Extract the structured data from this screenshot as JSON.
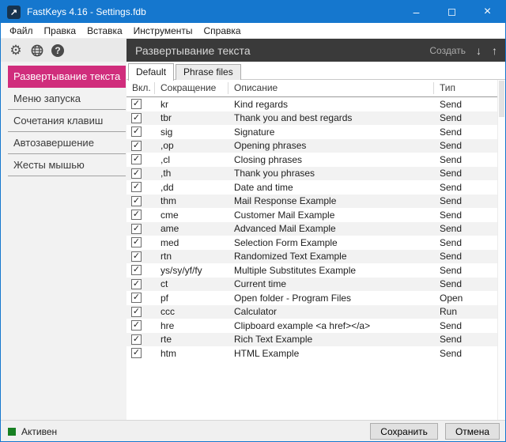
{
  "colors": {
    "titlebar": "#1577CE",
    "accent": "#D02D7C",
    "dark": "#3A3A3A",
    "green": "#178022"
  },
  "icons": {
    "app_arrow": "↗",
    "minimize": "–",
    "close": "×",
    "gear": "⚙",
    "help": "?",
    "arrow_down": "↓",
    "arrow_up": "↑",
    "check": "✓"
  },
  "window": {
    "title": "FastKeys 4.16  - Settings.fdb"
  },
  "menu": {
    "items": [
      "Файл",
      "Правка",
      "Вставка",
      "Инструменты",
      "Справка"
    ]
  },
  "sidebar": {
    "active_index": 0,
    "items": [
      "Развертывание текста",
      "Меню запуска",
      "Сочетания клавиш",
      "Автозавершение",
      "Жесты мышью"
    ]
  },
  "panel": {
    "header": {
      "title": "Развертывание текста",
      "create_label": "Создать"
    },
    "tabs": [
      {
        "label": "Default",
        "active": true
      },
      {
        "label": "Phrase files",
        "active": false
      }
    ]
  },
  "table": {
    "columns": [
      "Вкл.",
      "Сокращение",
      "Описание",
      "Тип"
    ],
    "rows": [
      {
        "enabled": true,
        "abbr": "kr",
        "desc": "Kind regards",
        "type": "Send"
      },
      {
        "enabled": true,
        "abbr": "tbr",
        "desc": "Thank you and best regards",
        "type": "Send"
      },
      {
        "enabled": true,
        "abbr": "sig",
        "desc": "Signature",
        "type": "Send"
      },
      {
        "enabled": true,
        "abbr": ",op",
        "desc": "Opening phrases",
        "type": "Send"
      },
      {
        "enabled": true,
        "abbr": ",cl",
        "desc": "Closing phrases",
        "type": "Send"
      },
      {
        "enabled": true,
        "abbr": ",th",
        "desc": "Thank you phrases",
        "type": "Send"
      },
      {
        "enabled": true,
        "abbr": ",dd",
        "desc": "Date and time",
        "type": "Send"
      },
      {
        "enabled": true,
        "abbr": "thm",
        "desc": "Mail Response Example",
        "type": "Send"
      },
      {
        "enabled": true,
        "abbr": "cme",
        "desc": "Customer Mail Example",
        "type": "Send"
      },
      {
        "enabled": true,
        "abbr": "ame",
        "desc": "Advanced Mail Example",
        "type": "Send"
      },
      {
        "enabled": true,
        "abbr": "med",
        "desc": "Selection Form Example",
        "type": "Send"
      },
      {
        "enabled": true,
        "abbr": "rtn",
        "desc": "Randomized Text Example",
        "type": "Send"
      },
      {
        "enabled": true,
        "abbr": "ys/sy/yf/fy",
        "desc": "Multiple Substitutes Example",
        "type": "Send"
      },
      {
        "enabled": true,
        "abbr": "ct",
        "desc": "Current time",
        "type": "Send"
      },
      {
        "enabled": true,
        "abbr": "pf",
        "desc": "Open folder - Program Files",
        "type": "Open"
      },
      {
        "enabled": true,
        "abbr": "ccc",
        "desc": "Calculator",
        "type": "Run"
      },
      {
        "enabled": true,
        "abbr": "hre",
        "desc": "Clipboard example <a href></a>",
        "type": "Send"
      },
      {
        "enabled": true,
        "abbr": "rte",
        "desc": "Rich Text Example",
        "type": "Send"
      },
      {
        "enabled": true,
        "abbr": "htm",
        "desc": "HTML Example",
        "type": "Send"
      }
    ]
  },
  "statusbar": {
    "label": "Активен"
  },
  "footer": {
    "save_label": "Сохранить",
    "cancel_label": "Отмена"
  }
}
